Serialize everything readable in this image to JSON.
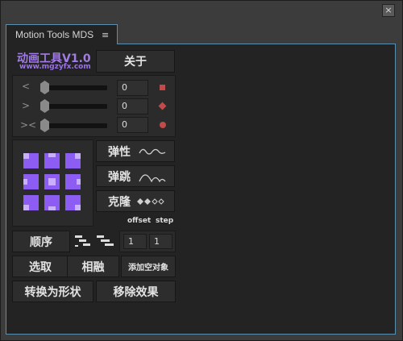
{
  "window": {
    "close_symbol": "×"
  },
  "tab": {
    "label": "Motion Tools MDS",
    "menu_symbol": "≡"
  },
  "logo": {
    "title": "动画工具V1.0",
    "url": "www.mgzyfx.com"
  },
  "about_label": "关于",
  "sliders": [
    {
      "arrow": "<",
      "value": "0",
      "marker": "square",
      "marker_color": "#c14a4a"
    },
    {
      "arrow": ">",
      "value": "0",
      "marker": "diamond",
      "marker_color": "#c14a4a"
    },
    {
      "arrow": "><",
      "value": "0",
      "marker": "circle",
      "marker_color": "#c14a4a"
    }
  ],
  "effects": [
    {
      "label": "弹性",
      "icon": "wave-icon"
    },
    {
      "label": "弹跳",
      "icon": "bounce-icon"
    },
    {
      "label": "克隆",
      "icon": "dots-icon"
    }
  ],
  "offset_label": "offset",
  "step_label": "step",
  "sequence": {
    "label": "顺序",
    "offset_value": "1",
    "step_value": "1"
  },
  "buttons": {
    "select": "选取",
    "blend": "相融",
    "add_null": "添加空对象",
    "convert_shape": "转换为形状",
    "remove_effects": "移除效果"
  },
  "colors": {
    "accent": "#8d5cf2",
    "panel_border": "#5a8fb0",
    "marker": "#c14a4a"
  }
}
